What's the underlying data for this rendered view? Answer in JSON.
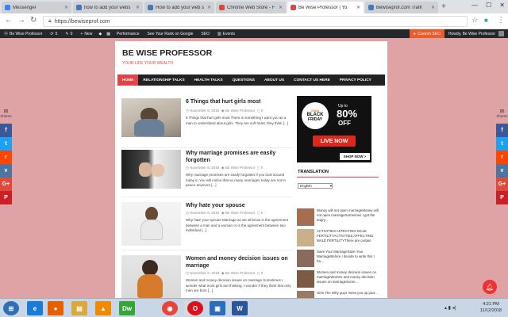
{
  "browser": {
    "tabs": [
      {
        "label": "Messenger",
        "color": "#3b82f6"
      },
      {
        "label": "how to add your webs",
        "color": "#4a76b8"
      },
      {
        "label": "How to add your web s",
        "color": "#4a76b8"
      },
      {
        "label": "Chrome Web Store - F",
        "color": "#e0463b"
      },
      {
        "label": "Be Wise Professor | Yo",
        "color": "#e04446"
      },
      {
        "label": "Bewiseprof.com Traffi",
        "color": "#4a76b8"
      }
    ],
    "url": "https://bewiseprof.com",
    "lock_text": "Secure"
  },
  "adminbar": {
    "items": [
      "Be Wise Professor",
      "5",
      "0",
      "New",
      "Performance",
      "See Your Rank on Google",
      "SEO",
      "Events"
    ],
    "right": [
      "Custom SEO",
      "Howdy, Be Wise Professor"
    ]
  },
  "site": {
    "title": "BE WISE PROFESSOR",
    "tagline": "YOUR LIFE YOUR WEALTH",
    "menu": [
      "HOME",
      "RELATIONSHIP TALKS",
      "HEALTH TALKS",
      "QUESTIONS",
      "ABOUT US",
      "CONTACT US HERE",
      "PRIVACY POLICY"
    ]
  },
  "posts": [
    {
      "title": "6 Things that hurt girls most",
      "date": "November 9, 2018",
      "author": "Be Wise Professor",
      "comments": "0",
      "excerpt": "6 Things that hurt girls most There is something I want you as a man to understand about girls. They are soft heart, they think [...]"
    },
    {
      "title": "Why marriage promises are easily forgotten",
      "date": "November 8, 2018",
      "author": "Be Wise Professor",
      "comments": "0",
      "excerpt": "Why marriage promises are easily forgotten If you look around today in You will notice that so many marriages today are not in peace anymore [...]"
    },
    {
      "title": "Why hate your spouse",
      "date": "November 8, 2018",
      "author": "Be Wise Professor",
      "comments": "0",
      "excerpt": "Why hate your spouse Marriage as we all know is the agreement between a man and a woman or is the agreement between two individual [...]"
    },
    {
      "title": "Women and money decision issues on marriage",
      "date": "November 6, 2018",
      "author": "Be Wise Professor",
      "comments": "0",
      "excerpt": "Women and money decision issues on marriage Sometimes I wonder what most girls are thinking. I wonder if they think that only men are born [...]"
    }
  ],
  "sidebar": {
    "promo": {
      "brand": "JUMIA",
      "headline1": "BLACK",
      "headline2": "FRIDAY",
      "upto": "Up to",
      "discount": "80%",
      "off": "OFF",
      "live": "LIVE NOW",
      "cta": "SHOP NOW >"
    },
    "translation_label": "TRANSLATION",
    "language": "English",
    "items": [
      "Money will not open marriageMoney will not open marriageSomeimes I got the angry...",
      "ACTIVITIES AFFECTING MALE FERTILITYACTIVITIES AFFECTING MALE FERTILITYThere are certain",
      "Save Your MarriageSave Your MarriageBefore I decide to write this I ha...",
      "Women and money decision issues on marriageWomen and money decision issues on marriageSome...",
      "Girls The Why guys mess you up part..."
    ]
  },
  "share": {
    "count": "55",
    "count_label": "Shares",
    "buttons": [
      {
        "name": "facebook",
        "glyph": "f",
        "color": "#3b5998"
      },
      {
        "name": "twitter",
        "glyph": "t",
        "color": "#1da1f2"
      },
      {
        "name": "reddit",
        "glyph": "r",
        "color": "#ff4500"
      },
      {
        "name": "vk",
        "glyph": "v",
        "color": "#4c75a3"
      },
      {
        "name": "google",
        "glyph": "G+",
        "color": "#dd4b39"
      },
      {
        "name": "pinterest",
        "glyph": "P",
        "color": "#cb2027"
      }
    ]
  },
  "taskbar": {
    "apps": [
      {
        "name": "start",
        "glyph": "⊞",
        "color": "#2f6fb5"
      },
      {
        "name": "ie",
        "glyph": "e",
        "color": "#1d7bd8"
      },
      {
        "name": "firefox",
        "glyph": "●",
        "color": "#e66000"
      },
      {
        "name": "explorer",
        "glyph": "▤",
        "color": "#d9a93c"
      },
      {
        "name": "vlc",
        "glyph": "▲",
        "color": "#f08a00"
      },
      {
        "name": "dreamweaver",
        "glyph": "Dw",
        "color": "#35a535"
      },
      {
        "name": "chrome",
        "glyph": "◉",
        "color": "#e7453a"
      },
      {
        "name": "app-blank",
        "glyph": "",
        "color": "#d9d9d9"
      },
      {
        "name": "opera",
        "glyph": "O",
        "color": "#d9121e"
      },
      {
        "name": "screen",
        "glyph": "▣",
        "color": "#2a6ebb"
      },
      {
        "name": "word",
        "glyph": "W",
        "color": "#2b579a"
      }
    ],
    "time": "4:21 PM",
    "date": "11/12/2018"
  }
}
